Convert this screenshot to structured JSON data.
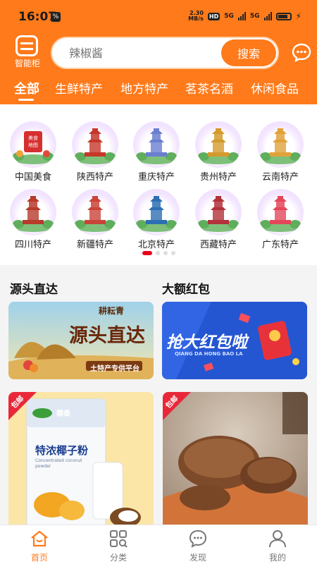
{
  "status_bar": {
    "time": "16:07",
    "notification_badge": "%",
    "net_speed_value": "2.30",
    "net_speed_unit": "MB/s",
    "hd_label": "HD",
    "signal_1": "5G",
    "signal_2": "5G",
    "battery_icon": "battery-icon"
  },
  "header": {
    "scan_label": "智能柜",
    "search_placeholder": "辣椒酱",
    "search_button": "搜索",
    "message_icon": "chat-bubble-icon",
    "tabs": [
      {
        "label": "全部",
        "active": true
      },
      {
        "label": "生鲜特产",
        "active": false
      },
      {
        "label": "地方特产",
        "active": false
      },
      {
        "label": "茗茶名酒",
        "active": false
      },
      {
        "label": "休闲食品",
        "active": false
      }
    ]
  },
  "categories": [
    {
      "label": "中国美食",
      "sign": "美食地图",
      "color": "#d62f2f"
    },
    {
      "label": "陕西特产",
      "color": "#c6372a"
    },
    {
      "label": "重庆特产",
      "color": "#6a7fd0"
    },
    {
      "label": "贵州特产",
      "color": "#d39a2d"
    },
    {
      "label": "云南特产",
      "color": "#e0a23a"
    },
    {
      "label": "四川特产",
      "color": "#b73a2a"
    },
    {
      "label": "新疆特产",
      "color": "#c9443a"
    },
    {
      "label": "北京特产",
      "color": "#2e6fb3"
    },
    {
      "label": "西藏特产",
      "color": "#b2313a"
    },
    {
      "label": "广东特产",
      "color": "#e4475a"
    }
  ],
  "carousel": {
    "pages": 4,
    "active": 0
  },
  "sections": {
    "left_title": "源头直达",
    "right_title": "大额红包",
    "left_banner": {
      "brand": "耕耘青",
      "headline": "源头直达",
      "subline": "土特产专供平台"
    },
    "right_banner": {
      "headline": "抢大红包啦",
      "pinyin": "QIANG DA HONG BAO LA"
    }
  },
  "products": [
    {
      "tag": "包邮",
      "package_title": "特浓椰子粉",
      "package_sub": "Concentrated coconut powder",
      "brand": "椰泰"
    },
    {
      "tag": "包邮"
    }
  ],
  "bottom_nav": [
    {
      "label": "首页",
      "icon": "home-icon",
      "active": true
    },
    {
      "label": "分类",
      "icon": "category-grid-icon",
      "active": false
    },
    {
      "label": "发现",
      "icon": "discover-chat-icon",
      "active": false
    },
    {
      "label": "我的",
      "icon": "profile-icon",
      "active": false
    }
  ],
  "colors": {
    "brand": "#ff7a1a",
    "accent_red": "#e8001f",
    "text": "#222222"
  }
}
